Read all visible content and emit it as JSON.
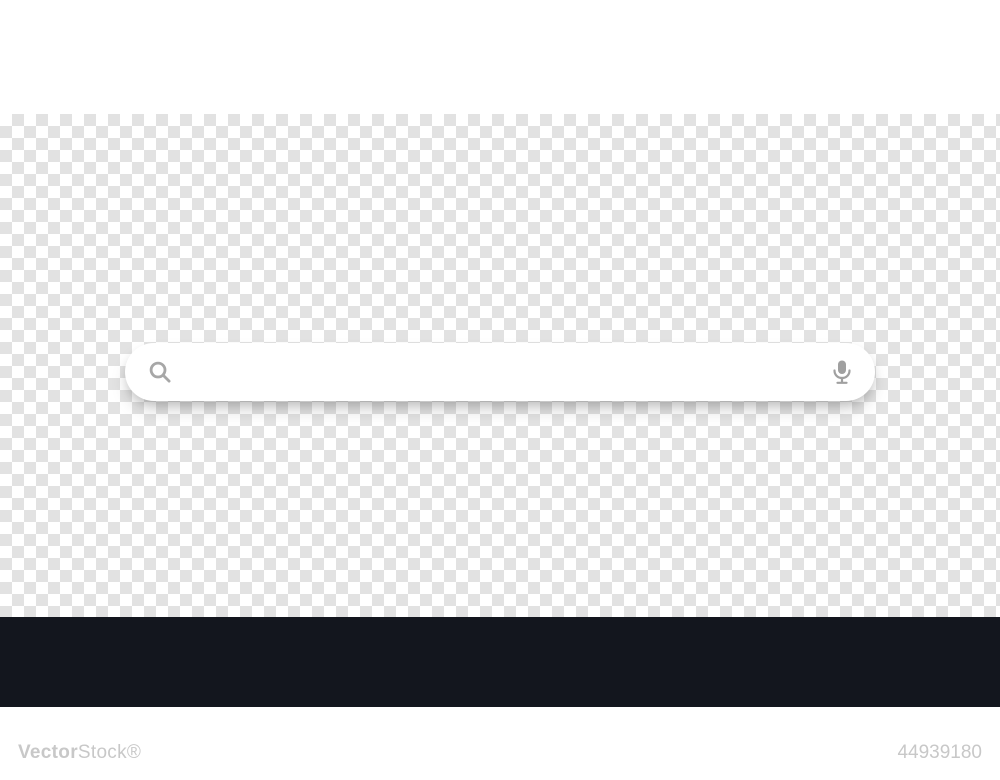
{
  "search": {
    "placeholder": "",
    "value": ""
  },
  "watermark": {
    "brand_bold": "Vector",
    "brand_light": "Stock",
    "suffix": "®",
    "image_id": "44939180"
  },
  "colors": {
    "icon": "#a7a7a7",
    "dark_strip": "#13161e",
    "checker_light": "#ffffff",
    "checker_dark": "#e2e2e2"
  }
}
